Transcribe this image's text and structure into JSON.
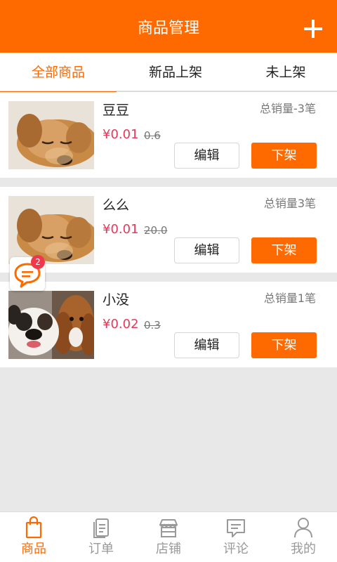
{
  "header": {
    "title": "商品管理",
    "add_icon": "plus-icon"
  },
  "tabs": [
    {
      "label": "全部商品",
      "active": true
    },
    {
      "label": "新品上架",
      "active": false
    },
    {
      "label": "未上架",
      "active": false
    }
  ],
  "products": [
    {
      "name": "豆豆",
      "sales": "总销量-3笔",
      "price": "¥0.01",
      "original_price": "0.6",
      "edit_label": "编辑",
      "off_label": "下架",
      "image": "puppy-photo"
    },
    {
      "name": "么么",
      "sales": "总销量3笔",
      "price": "¥0.01",
      "original_price": "20.0",
      "edit_label": "编辑",
      "off_label": "下架",
      "image": "puppy-photo"
    },
    {
      "name": "小没",
      "sales": "总销量1笔",
      "price": "¥0.02",
      "original_price": "0.3",
      "edit_label": "编辑",
      "off_label": "下架",
      "image": "dogs-photo"
    }
  ],
  "chat_float": {
    "icon": "chat-bubble-icon",
    "badge": "2"
  },
  "bottom_nav": [
    {
      "label": "商品",
      "icon": "shopping-bag-icon",
      "active": true
    },
    {
      "label": "订单",
      "icon": "document-icon",
      "active": false
    },
    {
      "label": "店铺",
      "icon": "store-icon",
      "active": false
    },
    {
      "label": "评论",
      "icon": "comment-icon",
      "active": false
    },
    {
      "label": "我的",
      "icon": "person-icon",
      "active": false
    }
  ],
  "colors": {
    "accent": "#ff6a00",
    "price": "#e8385a",
    "badge": "#f0384c",
    "background": "#e8e8e8"
  }
}
